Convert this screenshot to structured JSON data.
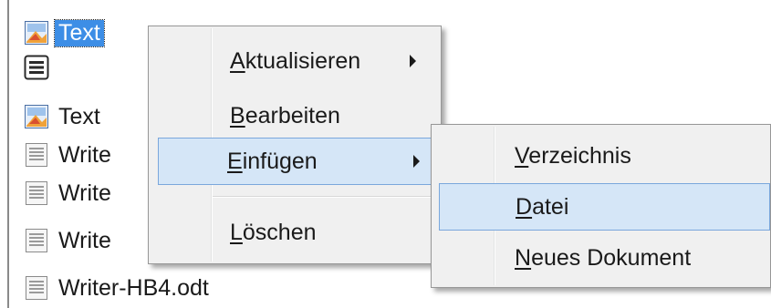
{
  "tree": {
    "items": [
      {
        "label": "Text",
        "icon": "region-icon",
        "selected": true
      },
      {
        "label": "",
        "icon": "section-icon"
      },
      {
        "label": "Text",
        "icon": "region-icon"
      },
      {
        "label": "Write",
        "icon": "document-icon"
      },
      {
        "label": "Write",
        "icon": "document-icon"
      },
      {
        "label": "Write",
        "icon": "document-icon"
      },
      {
        "label": "Writer-HB4.odt",
        "icon": "document-icon"
      }
    ]
  },
  "context_menu": {
    "items": [
      {
        "mnemonic": "A",
        "rest": "ktualisieren",
        "submenu": true
      },
      {
        "mnemonic": "B",
        "rest": "earbeiten",
        "submenu": false
      },
      {
        "mnemonic": "E",
        "rest": "infügen",
        "submenu": true,
        "highlighted": true
      },
      {
        "mnemonic": "L",
        "rest": "öschen",
        "submenu": false
      }
    ]
  },
  "submenu": {
    "items": [
      {
        "mnemonic": "V",
        "rest": "erzeichnis"
      },
      {
        "mnemonic": "D",
        "rest": "atei",
        "highlighted": true
      },
      {
        "mnemonic": "N",
        "rest": "eues Dokument"
      }
    ]
  },
  "colors": {
    "selection": "#3d8ee6",
    "menu_background": "#f0f0f0",
    "menu_hover": "#d5e6f7",
    "menu_hover_border": "#7aa7dc"
  }
}
